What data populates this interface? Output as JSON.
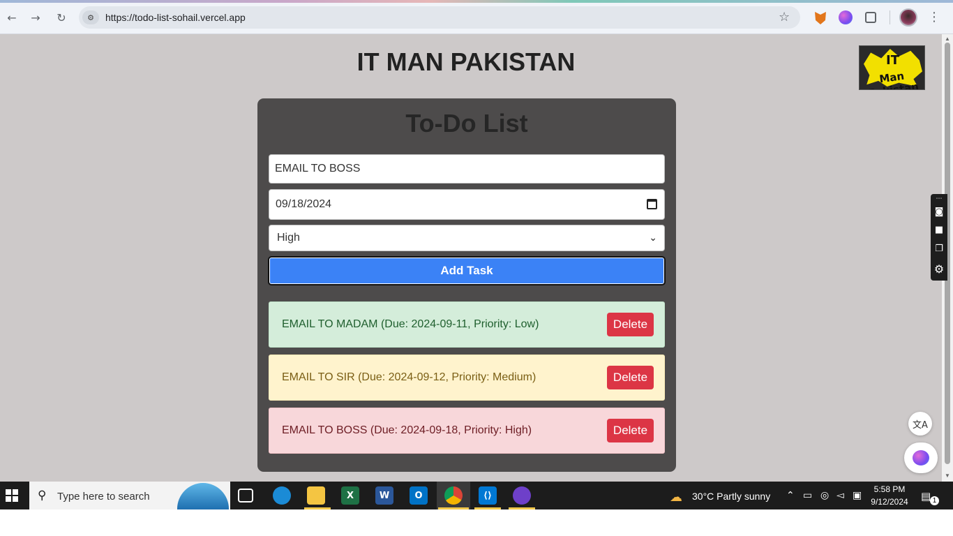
{
  "browser": {
    "url": "https://todo-list-sohail.vercel.app",
    "back_icon": "back-arrow-icon",
    "forward_icon": "forward-arrow-icon",
    "reload_icon": "reload-icon"
  },
  "page": {
    "site_title": "IT MAN PAKISTAN",
    "logo": {
      "line1": "IT",
      "line2": "Man Pakistan"
    }
  },
  "todo": {
    "title": "To-Do List",
    "task_input_value": "EMAIL TO BOSS",
    "date_value": "09/18/2024",
    "priority_selected": "High",
    "add_button": "Add Task",
    "tasks": [
      {
        "text": "EMAIL TO MADAM (Due: 2024-09-11, Priority: Low)",
        "priority": "Low",
        "delete_label": "Delete",
        "color": "#d4edda"
      },
      {
        "text": "EMAIL TO SIR (Due: 2024-09-12, Priority: Medium)",
        "priority": "Medium",
        "delete_label": "Delete",
        "color": "#fff3cd"
      },
      {
        "text": "EMAIL TO BOSS (Due: 2024-09-18, Priority: High)",
        "priority": "High",
        "delete_label": "Delete",
        "color": "#f8d7da"
      }
    ]
  },
  "taskbar": {
    "search_placeholder": "Type here to search",
    "weather": "30°C  Partly sunny",
    "time": "5:58 PM",
    "date": "9/12/2024",
    "notifications_count": "1"
  },
  "colors": {
    "page_bg": "#cdc9c9",
    "card_bg": "#4d4b4b",
    "add_button": "#3b82f6",
    "delete_button": "#dc3545"
  }
}
